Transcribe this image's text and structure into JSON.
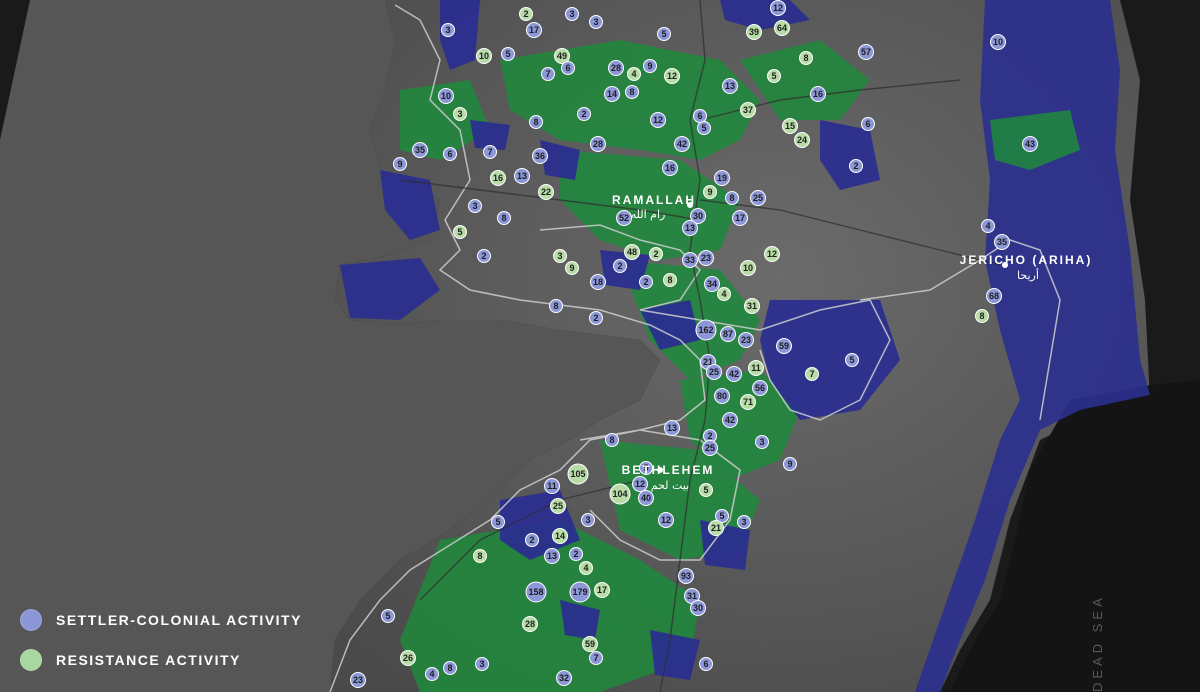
{
  "map": {
    "places": [
      {
        "id": "ramallah",
        "name": "RAMALLAH",
        "arabic": "رام الله"
      },
      {
        "id": "jericho",
        "name": "JERICHO (ARIHA)",
        "arabic": "أريحا"
      },
      {
        "id": "bethlehem",
        "name": "BETHLEHEM",
        "arabic": "بيت لحم"
      }
    ],
    "sea_label": "DEAD SEA",
    "legend": [
      {
        "key": "settler",
        "label": "SETTLER-COLONIAL ACTIVITY",
        "color": "#8c97d8"
      },
      {
        "key": "resistance",
        "label": "RESISTANCE ACTIVITY",
        "color": "#a8d8a0"
      }
    ],
    "colors": {
      "background": "#1a1a1a",
      "land": "#5c5c5c",
      "settlement_area": "#2b2f8f",
      "resistance_area": "#1e8a3c",
      "border": "#c9c9c9",
      "settler_marker": "#8c97d8",
      "resistance_marker": "#b8dca8"
    },
    "markers": [
      {
        "v": "2",
        "t": "r"
      },
      {
        "v": "3",
        "t": "s"
      },
      {
        "v": "3",
        "t": "s"
      },
      {
        "v": "5",
        "t": "s"
      },
      {
        "v": "12",
        "t": "s"
      },
      {
        "v": "64",
        "t": "r"
      },
      {
        "v": "57",
        "t": "s"
      },
      {
        "v": "8",
        "t": "r"
      },
      {
        "v": "3",
        "t": "s"
      },
      {
        "v": "17",
        "t": "s"
      },
      {
        "v": "49",
        "t": "r"
      },
      {
        "v": "6",
        "t": "s"
      },
      {
        "v": "10",
        "t": "r"
      },
      {
        "v": "5",
        "t": "s"
      },
      {
        "v": "39",
        "t": "r"
      },
      {
        "v": "7",
        "t": "s"
      },
      {
        "v": "28",
        "t": "s"
      },
      {
        "v": "4",
        "t": "r"
      },
      {
        "v": "9",
        "t": "s"
      },
      {
        "v": "12",
        "t": "r"
      },
      {
        "v": "13",
        "t": "s"
      },
      {
        "v": "5",
        "t": "r"
      },
      {
        "v": "14",
        "t": "s"
      },
      {
        "v": "8",
        "t": "s"
      },
      {
        "v": "10",
        "t": "s"
      },
      {
        "v": "3",
        "t": "r"
      },
      {
        "v": "37",
        "t": "r"
      },
      {
        "v": "15",
        "t": "r"
      },
      {
        "v": "16",
        "t": "s"
      },
      {
        "v": "2",
        "t": "s"
      },
      {
        "v": "12",
        "t": "s"
      },
      {
        "v": "6",
        "t": "s"
      },
      {
        "v": "8",
        "t": "s"
      },
      {
        "v": "5",
        "t": "s"
      },
      {
        "v": "28",
        "t": "s"
      },
      {
        "v": "42",
        "t": "s"
      },
      {
        "v": "24",
        "t": "r"
      },
      {
        "v": "36",
        "t": "s"
      },
      {
        "v": "35",
        "t": "s"
      },
      {
        "v": "13",
        "t": "s"
      },
      {
        "v": "7",
        "t": "s"
      },
      {
        "v": "6",
        "t": "s"
      },
      {
        "v": "9",
        "t": "s"
      },
      {
        "v": "16",
        "t": "r"
      },
      {
        "v": "2",
        "t": "s"
      },
      {
        "v": "22",
        "t": "r"
      },
      {
        "v": "16",
        "t": "s"
      },
      {
        "v": "19",
        "t": "s"
      },
      {
        "v": "9",
        "t": "r"
      },
      {
        "v": "8",
        "t": "s"
      },
      {
        "v": "25",
        "t": "s"
      },
      {
        "v": "30",
        "t": "s"
      },
      {
        "v": "52",
        "t": "s"
      },
      {
        "v": "13",
        "t": "s"
      },
      {
        "v": "17",
        "t": "s"
      },
      {
        "v": "3",
        "t": "s"
      },
      {
        "v": "8",
        "t": "s"
      },
      {
        "v": "5",
        "t": "r"
      },
      {
        "v": "2",
        "t": "s"
      },
      {
        "v": "12",
        "t": "r"
      },
      {
        "v": "6",
        "t": "s"
      },
      {
        "v": "43",
        "t": "s"
      },
      {
        "v": "4",
        "t": "s"
      },
      {
        "v": "35",
        "t": "s"
      },
      {
        "v": "68",
        "t": "s"
      },
      {
        "v": "8",
        "t": "r"
      },
      {
        "v": "10",
        "t": "s"
      },
      {
        "v": "48",
        "t": "r"
      },
      {
        "v": "2",
        "t": "r"
      },
      {
        "v": "33",
        "t": "s"
      },
      {
        "v": "23",
        "t": "s"
      },
      {
        "v": "10",
        "t": "r"
      },
      {
        "v": "3",
        "t": "r"
      },
      {
        "v": "9",
        "t": "r"
      },
      {
        "v": "2",
        "t": "s"
      },
      {
        "v": "2",
        "t": "s"
      },
      {
        "v": "34",
        "t": "s"
      },
      {
        "v": "4",
        "t": "r"
      },
      {
        "v": "8",
        "t": "r"
      },
      {
        "v": "18",
        "t": "s"
      },
      {
        "v": "8",
        "t": "s"
      },
      {
        "v": "2",
        "t": "s"
      },
      {
        "v": "31",
        "t": "r"
      },
      {
        "v": "162",
        "t": "s"
      },
      {
        "v": "87",
        "t": "s"
      },
      {
        "v": "23",
        "t": "s"
      },
      {
        "v": "59",
        "t": "s"
      },
      {
        "v": "5",
        "t": "s"
      },
      {
        "v": "7",
        "t": "r"
      },
      {
        "v": "21",
        "t": "s"
      },
      {
        "v": "25",
        "t": "s"
      },
      {
        "v": "42",
        "t": "s"
      },
      {
        "v": "11",
        "t": "r"
      },
      {
        "v": "56",
        "t": "s"
      },
      {
        "v": "80",
        "t": "s"
      },
      {
        "v": "71",
        "t": "r"
      },
      {
        "v": "42",
        "t": "s"
      },
      {
        "v": "13",
        "t": "s"
      },
      {
        "v": "2",
        "t": "s"
      },
      {
        "v": "25",
        "t": "s"
      },
      {
        "v": "3",
        "t": "s"
      },
      {
        "v": "9",
        "t": "s"
      },
      {
        "v": "8",
        "t": "s"
      },
      {
        "v": "105",
        "t": "r"
      },
      {
        "v": "11",
        "t": "s"
      },
      {
        "v": "5",
        "t": "s"
      },
      {
        "v": "12",
        "t": "s"
      },
      {
        "v": "104",
        "t": "r"
      },
      {
        "v": "40",
        "t": "s"
      },
      {
        "v": "5",
        "t": "r"
      },
      {
        "v": "25",
        "t": "r"
      },
      {
        "v": "3",
        "t": "s"
      },
      {
        "v": "12",
        "t": "s"
      },
      {
        "v": "5",
        "t": "s"
      },
      {
        "v": "21",
        "t": "r"
      },
      {
        "v": "3",
        "t": "s"
      },
      {
        "v": "5",
        "t": "s"
      },
      {
        "v": "2",
        "t": "s"
      },
      {
        "v": "14",
        "t": "r"
      },
      {
        "v": "8",
        "t": "r"
      },
      {
        "v": "13",
        "t": "s"
      },
      {
        "v": "2",
        "t": "s"
      },
      {
        "v": "4",
        "t": "r"
      },
      {
        "v": "158",
        "t": "s"
      },
      {
        "v": "179",
        "t": "s"
      },
      {
        "v": "17",
        "t": "r"
      },
      {
        "v": "93",
        "t": "s"
      },
      {
        "v": "31",
        "t": "s"
      },
      {
        "v": "30",
        "t": "s"
      },
      {
        "v": "5",
        "t": "s"
      },
      {
        "v": "28",
        "t": "r"
      },
      {
        "v": "59",
        "t": "r"
      },
      {
        "v": "26",
        "t": "r"
      },
      {
        "v": "8",
        "t": "s"
      },
      {
        "v": "23",
        "t": "s"
      },
      {
        "v": "4",
        "t": "s"
      },
      {
        "v": "32",
        "t": "s"
      },
      {
        "v": "7",
        "t": "s"
      },
      {
        "v": "3",
        "t": "s"
      },
      {
        "v": "6",
        "t": "s"
      }
    ]
  }
}
